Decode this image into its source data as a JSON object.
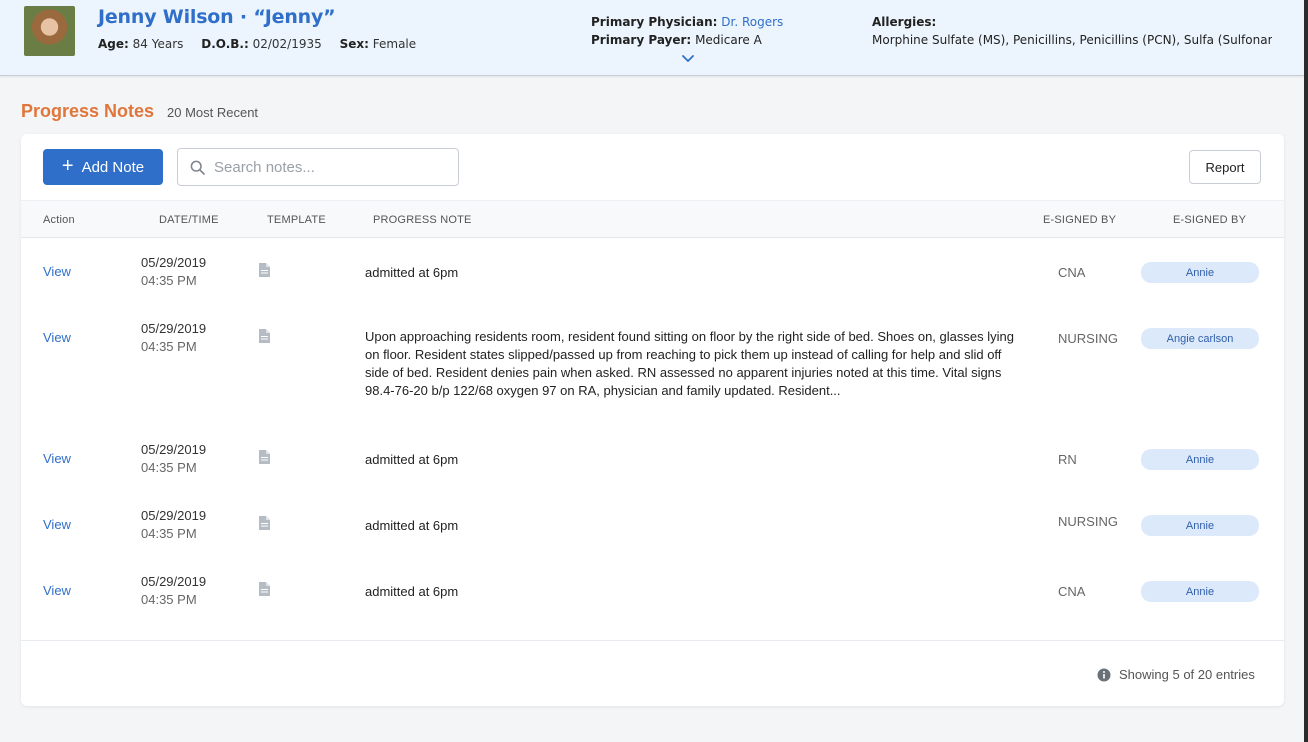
{
  "patient": {
    "name": "Jenny Wilson · “Jenny”",
    "age_label": "Age:",
    "age": "84 Years",
    "dob_label": "D.O.B.:",
    "dob": "02/02/1935",
    "sex_label": "Sex:",
    "sex": "Female",
    "physician_label": "Primary Physician:",
    "physician": "Dr. Rogers",
    "payer_label": "Primary Payer:",
    "payer": "Medicare A",
    "allergies_label": "Allergies:",
    "allergies": "Morphine Sulfate (MS), Penicillins, Penicillins (PCN), Sulfa (Sulfonami..."
  },
  "page": {
    "title": "Progress Notes",
    "subtitle": "20 Most Recent"
  },
  "toolbar": {
    "add_label": "Add Note",
    "search_placeholder": "Search notes...",
    "report_label": "Report"
  },
  "table": {
    "headers": [
      "Action",
      "DATE/TIME",
      "TEMPLATE",
      "PROGRESS NOTE",
      "E-SIGNED BY",
      "E-SIGNED BY"
    ],
    "rows": [
      {
        "action": "View",
        "date": "05/29/2019",
        "time": "04:35 PM",
        "note": "admitted at 6pm",
        "role": "CNA",
        "signer": "Annie"
      },
      {
        "action": "View",
        "date": "05/29/2019",
        "time": "04:35 PM",
        "note": "Upon approaching residents room, resident found sitting on floor by the right side of bed. Shoes on, glasses lying on floor. Resident states slipped/passed up from reaching to pick them up instead of calling for help and slid off side of bed. Resident denies pain when asked. RN assessed no apparent injuries noted at this time. Vital signs 98.4-76-20 b/p 122/68 oxygen 97 on RA, physician and family updated. Resident...",
        "role": "NURSING",
        "signer": "Angie carlson"
      },
      {
        "action": "View",
        "date": "05/29/2019",
        "time": "04:35 PM",
        "note": "admitted at 6pm",
        "role": "RN",
        "signer": "Annie"
      },
      {
        "action": "View",
        "date": "05/29/2019",
        "time": "04:35 PM",
        "note": "admitted at 6pm",
        "role": "NURSING",
        "signer": "Annie"
      },
      {
        "action": "View",
        "date": "05/29/2019",
        "time": "04:35 PM",
        "note": "admitted at 6pm",
        "role": "CNA",
        "signer": "Annie"
      }
    ]
  },
  "footer": {
    "showing": "Showing 5 of 20 entries"
  },
  "colors": {
    "accent": "#2f6fc9",
    "title_orange": "#e0763a",
    "badge_bg": "#dce9fb"
  },
  "icons": [
    "avatar-photo",
    "chevron-down-icon",
    "plus-icon",
    "search-icon",
    "document-icon",
    "info-icon"
  ]
}
